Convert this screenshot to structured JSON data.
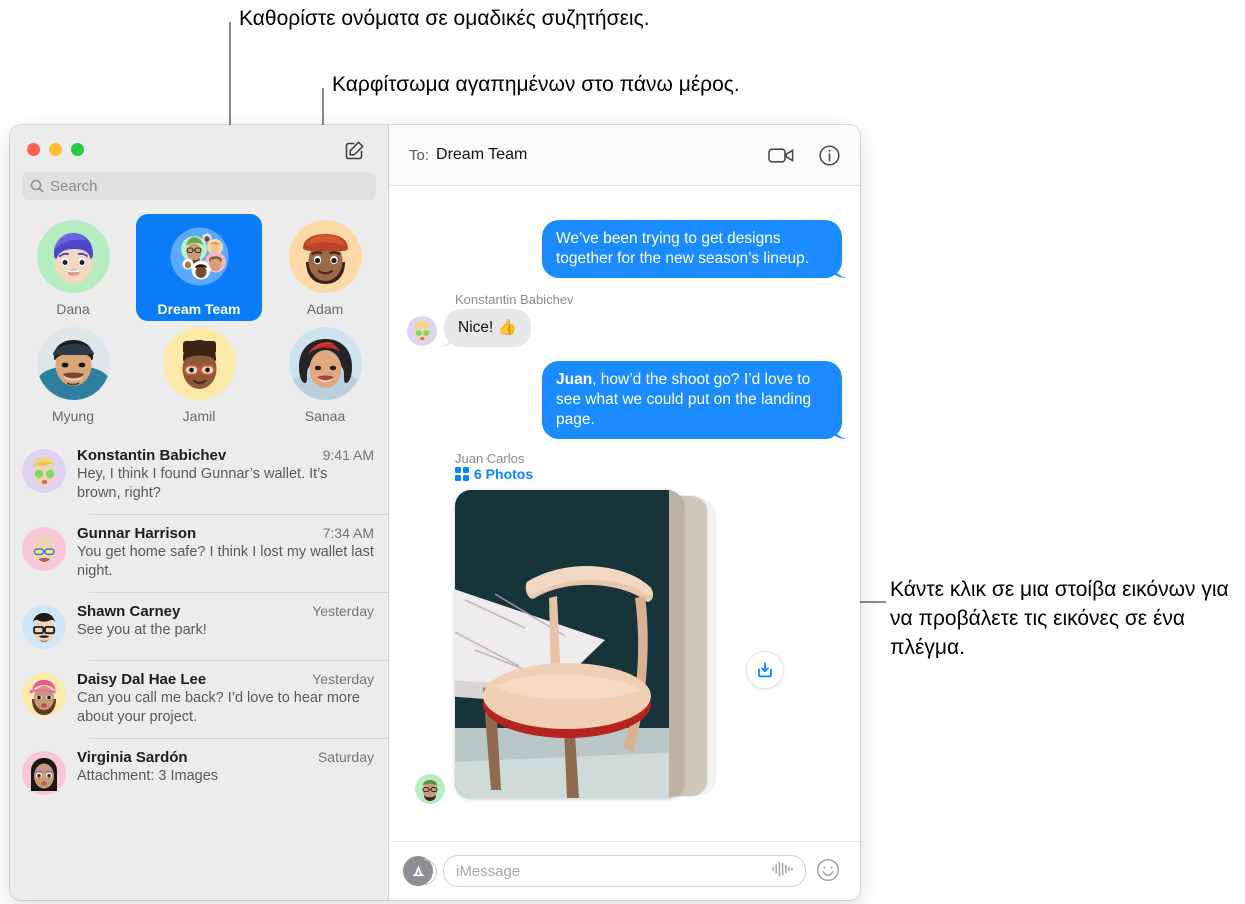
{
  "callouts": [
    {
      "id": "group-names",
      "text": "Καθορίστε ονόματα σε ομαδικές συζητήσεις."
    },
    {
      "id": "pin-favorites",
      "text": "Καρφίτσωμα αγαπημένων στο πάνω μέρος."
    },
    {
      "id": "photo-stack",
      "text": "Κάντε κλικ σε μια στοίβα εικόνων για να προβάλετε τις εικόνες σε ένα πλέγμα."
    }
  ],
  "window": {
    "traffic_lights": {
      "close": "close-button",
      "minimize": "minimize-button",
      "zoom": "zoom-button"
    },
    "compose_icon": "compose-icon"
  },
  "sidebar": {
    "search": {
      "placeholder": "Search",
      "icon": "search-icon"
    },
    "pinned": [
      {
        "name": "Dana",
        "selected": false
      },
      {
        "name": "Dream Team",
        "selected": true
      },
      {
        "name": "Adam",
        "selected": false
      },
      {
        "name": "Myung",
        "selected": false
      },
      {
        "name": "Jamil",
        "selected": false
      },
      {
        "name": "Sanaa",
        "selected": false
      }
    ],
    "conversations": [
      {
        "name": "Konstantin Babichev",
        "time": "9:41 AM",
        "preview": "Hey, I think I found Gunnar’s wallet. It’s brown, right?"
      },
      {
        "name": "Gunnar Harrison",
        "time": "7:34 AM",
        "preview": "You get home safe? I think I lost my wallet last night."
      },
      {
        "name": "Shawn Carney",
        "time": "Yesterday",
        "preview": "See you at the park!"
      },
      {
        "name": "Daisy Dal Hae Lee",
        "time": "Yesterday",
        "preview": "Can you call me back? I’d love to hear more about your project."
      },
      {
        "name": "Virginia Sardón",
        "time": "Saturday",
        "preview": "Attachment: 3 Images"
      }
    ]
  },
  "pane": {
    "header": {
      "to_label": "To:",
      "recipient": "Dream Team",
      "facetime_icon": "video-camera-icon",
      "info_icon": "info-icon"
    },
    "messages": [
      {
        "kind": "out",
        "text": "We’ve been trying to get designs together for the new season’s lineup."
      },
      {
        "kind": "in",
        "sender": "Konstantin Babichev",
        "text": "Nice!  👍"
      },
      {
        "kind": "out",
        "mention": "Juan",
        "text": ", how’d the shoot go? I’d love to see what we could put on the landing page."
      },
      {
        "kind": "photos",
        "sender": "Juan Carlos",
        "count_label": "6 Photos",
        "grid_icon": "grid-icon",
        "download_icon": "download-icon"
      }
    ],
    "composer": {
      "apps_icon": "app-store-icon",
      "placeholder": "iMessage",
      "audio_icon": "audio-waveform-icon",
      "emoji_icon": "smiley-icon"
    }
  },
  "colors": {
    "accent_blue": "#1a8cff",
    "selected_blue": "#0a7cf8",
    "link_blue": "#0a84ff",
    "bubble_gray": "#e7e7e9",
    "sidebar_bg": "#ececec"
  }
}
